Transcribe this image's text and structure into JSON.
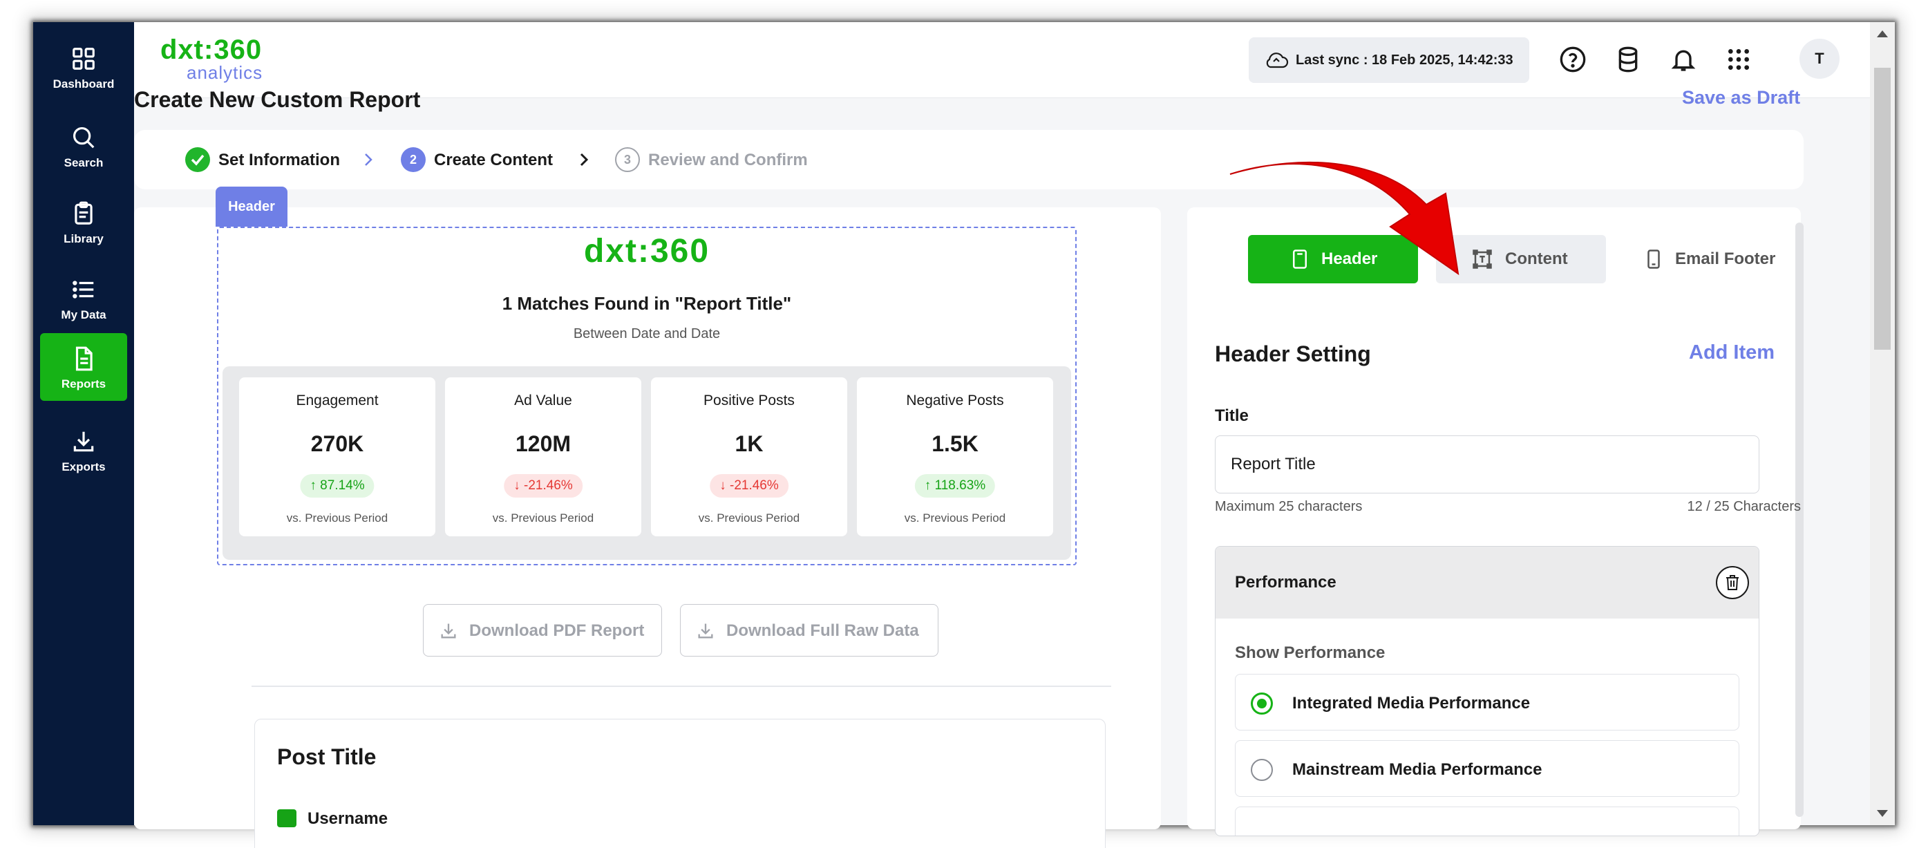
{
  "sidebar": {
    "items": [
      {
        "label": "Dashboard",
        "icon": "dashboard-icon",
        "active": false
      },
      {
        "label": "Search",
        "icon": "search-icon",
        "active": false
      },
      {
        "label": "Library",
        "icon": "clipboard-icon",
        "active": false
      },
      {
        "label": "My Data",
        "icon": "list-icon",
        "active": false
      },
      {
        "label": "Reports",
        "icon": "document-icon",
        "active": true
      },
      {
        "label": "Exports",
        "icon": "download-icon",
        "active": false
      }
    ]
  },
  "header": {
    "logo_main": "dxt:360",
    "logo_sub": "analytics",
    "sync_text": "Last sync : 18 Feb 2025, 14:42:33",
    "avatar_initial": "T"
  },
  "page": {
    "title": "Create New Custom Report",
    "save_draft": "Save as Draft"
  },
  "stepper": {
    "steps": [
      {
        "number": "1",
        "label": "Set Information",
        "state": "done"
      },
      {
        "number": "2",
        "label": "Create Content",
        "state": "current"
      },
      {
        "number": "3",
        "label": "Review and Confirm",
        "state": "pending"
      }
    ]
  },
  "preview": {
    "section_tag": "Header",
    "logo": "dxt:360",
    "title": "1 Matches Found in \"Report Title\"",
    "subtitle": "Between Date and Date",
    "metrics": [
      {
        "label": "Engagement",
        "value": "270K",
        "change": "87.14%",
        "direction": "up",
        "note": "vs. Previous Period"
      },
      {
        "label": "Ad Value",
        "value": "120M",
        "change": "-21.46%",
        "direction": "down",
        "note": "vs. Previous Period"
      },
      {
        "label": "Positive Posts",
        "value": "1K",
        "change": "-21.46%",
        "direction": "down",
        "note": "vs. Previous Period"
      },
      {
        "label": "Negative Posts",
        "value": "1.5K",
        "change": "118.63%",
        "direction": "up",
        "note": "vs. Previous Period"
      }
    ],
    "download_pdf": "Download PDF Report",
    "download_raw": "Download Full Raw Data",
    "post_title": "Post Title",
    "post_username": "Username"
  },
  "settings": {
    "tabs": [
      {
        "label": "Header",
        "icon": "header-icon",
        "active": true
      },
      {
        "label": "Content",
        "icon": "text-box-icon",
        "active": false
      },
      {
        "label": "Email Footer",
        "icon": "mobile-icon",
        "active": false
      }
    ],
    "section_title": "Header Setting",
    "add_item": "Add Item",
    "title_label": "Title",
    "title_value": "Report Title",
    "title_help": "Maximum 25 characters",
    "title_count": "12 / 25 Characters",
    "performance": {
      "title": "Performance",
      "show_label": "Show Performance",
      "options": [
        {
          "label": "Integrated Media Performance",
          "selected": true
        },
        {
          "label": "Mainstream Media Performance",
          "selected": false
        }
      ]
    }
  },
  "colors": {
    "brand_green": "#16b316",
    "accent_purple": "#6f7fe6",
    "sidebar_bg": "#071a3b",
    "annotation_red": "#e60000"
  }
}
